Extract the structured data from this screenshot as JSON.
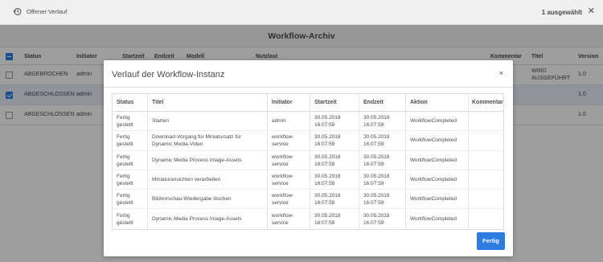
{
  "topbar": {
    "history_label": "Offener Verlauf",
    "selected_label": "1 ausgewählt",
    "close_icon": "close-icon"
  },
  "archive": {
    "title": "Workflow-Archiv",
    "columns": [
      "Status",
      "Initiator",
      "Startzeit",
      "Endzeit",
      "Modell",
      "Nutzlast",
      "Kommentar",
      "Titel",
      "Version"
    ],
    "rows": [
      {
        "status": "ABGEBROCHEN",
        "initiator": "admin",
        "titel": "WIRD AUSGEFÜHRT",
        "version": "1.0",
        "checked": false
      },
      {
        "status": "ABGESCHLOSSEN",
        "initiator": "admin",
        "titel": "",
        "version": "1.0",
        "checked": true
      },
      {
        "status": "ABGESCHLOSSEN",
        "initiator": "admin",
        "titel": "",
        "version": "1.0",
        "checked": false
      }
    ]
  },
  "modal": {
    "title": "Verlauf der Workflow-Instanz",
    "close_label": "×",
    "columns": {
      "status": "Status",
      "titel": "Titel",
      "initiator": "Initiator",
      "startzeit": "Startzeit",
      "endzeit": "Endzeit",
      "aktion": "Aktion",
      "kommentar": "Kommentar"
    },
    "rows": [
      {
        "status": [
          "Fertig",
          "gestellt"
        ],
        "titel": [
          "Starten"
        ],
        "initiator": [
          "admin"
        ],
        "start": [
          "30.05.2018",
          "16:07:59"
        ],
        "end": [
          "30.05.2018",
          "16:07:59"
        ],
        "aktion": "WorkflowCompleted"
      },
      {
        "status": [
          "Fertig",
          "gestellt"
        ],
        "titel": [
          "Download-Vorgang für Miniatursatz für",
          "Dynamic Media-Video"
        ],
        "initiator": [
          "workflow-",
          "service"
        ],
        "start": [
          "30.05.2018",
          "16:07:59"
        ],
        "end": [
          "30.05.2018",
          "16:07:59"
        ],
        "aktion": "WorkflowCompleted"
      },
      {
        "status": [
          "Fertig",
          "gestellt"
        ],
        "titel": [
          "Dynamic Media Process Image-Assets"
        ],
        "initiator": [
          "workflow-",
          "service"
        ],
        "start": [
          "30.05.2018",
          "16:07:59"
        ],
        "end": [
          "30.05.2018",
          "16:07:59"
        ],
        "aktion": "WorkflowCompleted"
      },
      {
        "status": [
          "Fertig",
          "gestellt"
        ],
        "titel": [
          "Miniaturansichten verarbeiten"
        ],
        "initiator": [
          "workflow-",
          "service"
        ],
        "start": [
          "30.05.2018",
          "16:07:59"
        ],
        "end": [
          "30.05.2018",
          "16:07:59"
        ],
        "aktion": "WorkflowCompleted"
      },
      {
        "status": [
          "Fertig",
          "gestellt"
        ],
        "titel": [
          "Bildvorschau-Wiedergabe löschen"
        ],
        "initiator": [
          "workflow-",
          "service"
        ],
        "start": [
          "30.05.2018",
          "16:07:59"
        ],
        "end": [
          "30.05.2018",
          "16:07:59"
        ],
        "aktion": "WorkflowCompleted"
      },
      {
        "status": [
          "Fertig",
          "gestellt"
        ],
        "titel": [
          "Dynamic Media Process Image-Assets"
        ],
        "initiator": [
          "workflow-",
          "service"
        ],
        "start": [
          "30.05.2018",
          "16:07:59"
        ],
        "end": [
          "30.05.2018",
          "16:07:59"
        ],
        "aktion": "WorkflowCompleted"
      }
    ],
    "done_label": "Fertig"
  },
  "colors": {
    "accent": "#2d7ae0",
    "overlay": "#000000"
  }
}
